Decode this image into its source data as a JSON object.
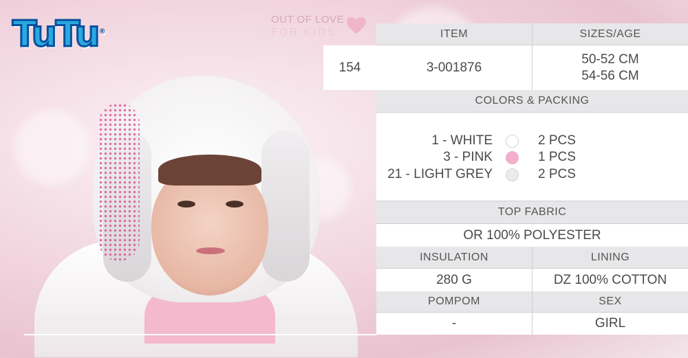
{
  "brand": {
    "logo_text": "TuTu",
    "registered": "®"
  },
  "tagline": {
    "line1": "OUT OF LOVE",
    "line2": "FOR KIDS"
  },
  "colors_theme": {
    "heart": "#f0b6c8",
    "header_bg": "#e7e7e9",
    "cell_bg": "#ffffff",
    "brand_blue": "#29a9e1"
  },
  "product": {
    "number": "154",
    "item_header": "ITEM",
    "item": "3-001876",
    "sizes_header": "SIZES/AGE",
    "sizes": [
      "50-52 CM",
      "54-56 CM"
    ],
    "colors_header": "COLORS & PACKING",
    "colors": [
      {
        "label": "1 - WHITE",
        "swatch": "#ffffff",
        "packing": "2 PCS"
      },
      {
        "label": "3 - PINK",
        "swatch": "#f2aeca",
        "packing": "1 PCS"
      },
      {
        "label": "21 - LIGHT GREY",
        "swatch": "#ebebec",
        "packing": "2 PCS"
      }
    ],
    "top_fabric_header": "TOP FABRIC",
    "top_fabric": "OR 100% POLYESTER",
    "insulation_header": "INSULATION",
    "insulation": "280 G",
    "lining_header": "LINING",
    "lining": "DZ 100% COTTON",
    "pompom_header": "POMPOM",
    "pompom": "-",
    "sex_header": "SEX",
    "sex": "GIRL"
  }
}
